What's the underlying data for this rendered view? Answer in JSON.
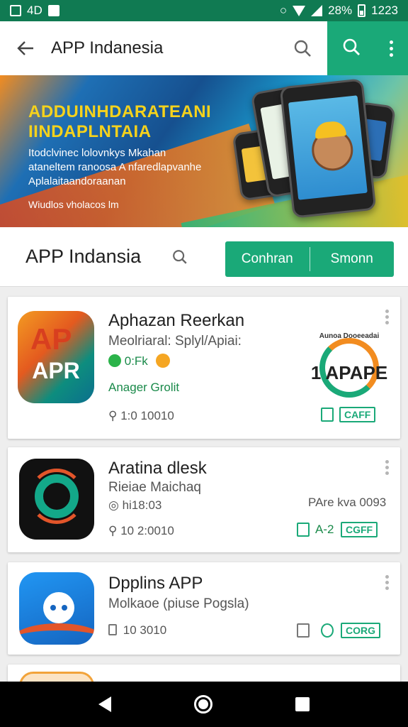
{
  "status_bar": {
    "left_text": "4D",
    "battery": "28%",
    "time": "1223"
  },
  "app_bar": {
    "title": "APP Indanesia"
  },
  "banner": {
    "headline_1": "ADDUINHDARATEANI",
    "headline_2": "IINDAPLNTAIA",
    "sub_1": "Itodclvinec lolovnkys Mkahan",
    "sub_2": "ataneltem ranoosa A nfaredlapvanhe",
    "sub_3": "Aplalaitaandoraanan",
    "note": "Wiudlos vholacos lm"
  },
  "section": {
    "title": "APP Indansia",
    "seg_left": "Conhran",
    "seg_right": "Smonn"
  },
  "apps": [
    {
      "title": "Aphazan Reerkan",
      "subtitle": "Meolriaral: Splyl/Apiai:",
      "rating_label": "0:Fk",
      "developer": "Anager Grolit",
      "meta": "1:0 10010",
      "tag": "CAFF",
      "icon_text": "APR",
      "icon_top": "AP",
      "seal_text": "1 APAPE",
      "seal_arc": "Aunoa Dooeeadai"
    },
    {
      "title": "Aratina dlesk",
      "subtitle": "Rieiae Maichaq",
      "rating_label": "hi18:03",
      "meta": "10 2:0010",
      "right_text": "PAre kva 0093",
      "version": "A-2",
      "tag": "CGFF"
    },
    {
      "title": "Dpplins APP",
      "subtitle": "Molkaoe (piuse Pogsla)",
      "meta": "10 3010",
      "tag": "CORG"
    }
  ],
  "colors": {
    "brand_green": "#1aa978",
    "status_green": "#107a52"
  },
  "icons": [
    "arrow-back-icon",
    "search-icon",
    "more-vert-icon",
    "wifi-icon",
    "signal-icon",
    "battery-icon"
  ]
}
